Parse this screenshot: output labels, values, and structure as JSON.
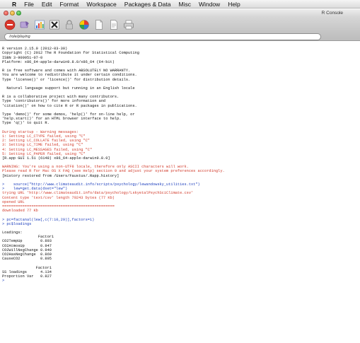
{
  "menubar": {
    "apple_glyph": "",
    "items": [
      "R",
      "File",
      "Edit",
      "Format",
      "Workspace",
      "Packages & Data",
      "Misc",
      "Window",
      "Help"
    ]
  },
  "window": {
    "title": "R Console"
  },
  "toolbar": {
    "buttons": [
      {
        "name": "stop-icon",
        "color": "#d9362b"
      },
      {
        "name": "source-script-icon",
        "color": "#7a5ca8"
      },
      {
        "name": "quartz-graphics-icon",
        "color": "#3a7ad6"
      },
      {
        "name": "x11-icon",
        "color": "#222222"
      },
      {
        "name": "authorize-icon",
        "color": "#9a9a9a"
      },
      {
        "name": "color-wheel-icon",
        "color": "#ffcc00"
      },
      {
        "name": "new-document-icon",
        "color": "#8a8a8a"
      },
      {
        "name": "open-document-icon",
        "color": "#8a8a8a"
      },
      {
        "name": "print-icon",
        "color": "#666666"
      }
    ]
  },
  "working_directory": "/role/playing",
  "console": {
    "lines": [
      {
        "t": "",
        "k": "blank"
      },
      {
        "t": "R version 2.15.0 (2012-03-30)",
        "k": "output"
      },
      {
        "t": "Copyright (C) 2012 The R Foundation for Statistical Computing",
        "k": "output"
      },
      {
        "t": "ISBN 3-900051-07-0",
        "k": "output"
      },
      {
        "t": "Platform: x86_64-apple-darwin9.8.0/x86_64 (64-bit)",
        "k": "output"
      },
      {
        "t": "",
        "k": "blank"
      },
      {
        "t": "R is free software and comes with ABSOLUTELY NO WARRANTY.",
        "k": "output"
      },
      {
        "t": "You are welcome to redistribute it under certain conditions.",
        "k": "output"
      },
      {
        "t": "Type 'license()' or 'licence()' for distribution details.",
        "k": "output"
      },
      {
        "t": "",
        "k": "blank"
      },
      {
        "t": "  Natural language support but running in an English locale",
        "k": "output"
      },
      {
        "t": "",
        "k": "blank"
      },
      {
        "t": "R is a collaborative project with many contributors.",
        "k": "output"
      },
      {
        "t": "Type 'contributors()' for more information and",
        "k": "output"
      },
      {
        "t": "'citation()' on how to cite R or R packages in publications.",
        "k": "output"
      },
      {
        "t": "",
        "k": "blank"
      },
      {
        "t": "Type 'demo()' for some demos, 'help()' for on-line help, or",
        "k": "output"
      },
      {
        "t": "'help.start()' for an HTML browser interface to help.",
        "k": "output"
      },
      {
        "t": "Type 'q()' to quit R.",
        "k": "output"
      },
      {
        "t": "",
        "k": "blank"
      },
      {
        "t": "During startup - Warning messages:",
        "k": "error"
      },
      {
        "t": "1: Setting LC_CTYPE failed, using \"C\"",
        "k": "error"
      },
      {
        "t": "2: Setting LC_COLLATE failed, using \"C\"",
        "k": "error"
      },
      {
        "t": "3: Setting LC_TIME failed, using \"C\"",
        "k": "error"
      },
      {
        "t": "4: Setting LC_MESSAGES failed, using \"C\"",
        "k": "error"
      },
      {
        "t": "5: Setting LC_PAPER failed, using \"C\"",
        "k": "error"
      },
      {
        "t": "[R.app GUI 1.51 (6148) x86_64-apple-darwin9.8.0]",
        "k": "output"
      },
      {
        "t": "",
        "k": "blank"
      },
      {
        "t": "WARNING: You're using a non-UTF8 locale, therefore only ASCII characters will work.",
        "k": "error"
      },
      {
        "t": "Please read R for Mac OS X FAQ (see Help) section 9 and adjust your system preferences accordingly.",
        "k": "error"
      },
      {
        "t": "[History restored from /Users/Faustus/.Rapp.history]",
        "k": "output"
      },
      {
        "t": "",
        "k": "blank"
      },
      {
        "t": ">    source(\"http://www.climateaudit.info/scripts/psychology/lewandowsky_utilities.txt\")",
        "k": "cmd"
      },
      {
        "t": ">    lew=get.data(dset=\"lew\")",
        "k": "cmd"
      },
      {
        "t": "trying URL 'http://www.climateaudit.info/data/psychology/LskyetalPsychSciClimate.csv'",
        "k": "error"
      },
      {
        "t": "Content type 'text/csv' length 79243 bytes (77 Kb)",
        "k": "error"
      },
      {
        "t": "opened URL",
        "k": "error"
      },
      {
        "t": "==================================================",
        "k": "error"
      },
      {
        "t": "downloaded 77 Kb",
        "k": "error"
      },
      {
        "t": "",
        "k": "blank"
      },
      {
        "t": "> pc=factanal(lew[,c(7:10,29)],factors=1)",
        "k": "cmd"
      },
      {
        "t": "> pc$loadings",
        "k": "cmd"
      },
      {
        "t": "",
        "k": "blank"
      },
      {
        "t": "Loadings:",
        "k": "output"
      },
      {
        "t": "                Factor1",
        "k": "output"
      },
      {
        "t": "CO2TempUp        0.893",
        "k": "output"
      },
      {
        "t": "CO2AtmosUp       0.947",
        "k": "output"
      },
      {
        "t": "CO2WillNegChange 0.940",
        "k": "output"
      },
      {
        "t": "CO2HasNegChange  0.869",
        "k": "output"
      },
      {
        "t": "CauseCO2         0.895",
        "k": "output"
      },
      {
        "t": "",
        "k": "blank"
      },
      {
        "t": "               Factor1",
        "k": "output"
      },
      {
        "t": "SS loadings      4.134",
        "k": "output"
      },
      {
        "t": "Proportion Var   0.827",
        "k": "output"
      },
      {
        "t": ">",
        "k": "cmd"
      }
    ]
  }
}
